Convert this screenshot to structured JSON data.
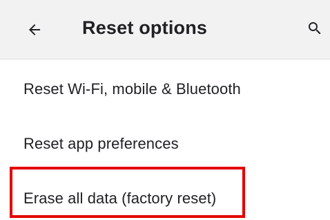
{
  "appbar": {
    "back_icon": "arrow-back-icon",
    "title": "Reset options",
    "search_icon": "search-icon"
  },
  "items": [
    {
      "label": "Reset Wi-Fi, mobile & Bluetooth"
    },
    {
      "label": "Reset app preferences"
    },
    {
      "label": "Erase all data (factory reset)"
    }
  ],
  "highlight": {
    "target": "Erase all data (factory reset)",
    "color": "#e60000"
  },
  "colors": {
    "appbar_bg": "#f2f2f2",
    "text": "#202124",
    "background": "#ffffff"
  }
}
